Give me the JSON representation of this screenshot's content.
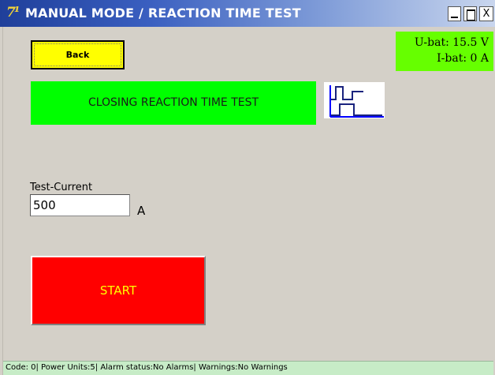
{
  "window": {
    "title": "MANUAL MODE / REACTION TIME TEST",
    "app_icon": "7¹",
    "minimize_icon": "minimize-icon",
    "maximize_icon": "maximize-icon",
    "close_label": "X"
  },
  "battery": {
    "u_bat": "U-bat: 15.5 V",
    "i_bat": "I-bat: 0 A",
    "color": "#66ff00"
  },
  "toolbar": {
    "back_label": "Back"
  },
  "test": {
    "label": "CLOSING REACTION TIME TEST",
    "label_color": "#00ff00",
    "waveform_icon": "step-waveform-icon"
  },
  "current": {
    "caption": "Test-Current",
    "value": "500",
    "unit": "A"
  },
  "actions": {
    "start_label": "START",
    "start_color": "#ff0000"
  },
  "status": {
    "text": "Code: 0| Power Units:5| Alarm status:No Alarms| Warnings:No Warnings"
  }
}
